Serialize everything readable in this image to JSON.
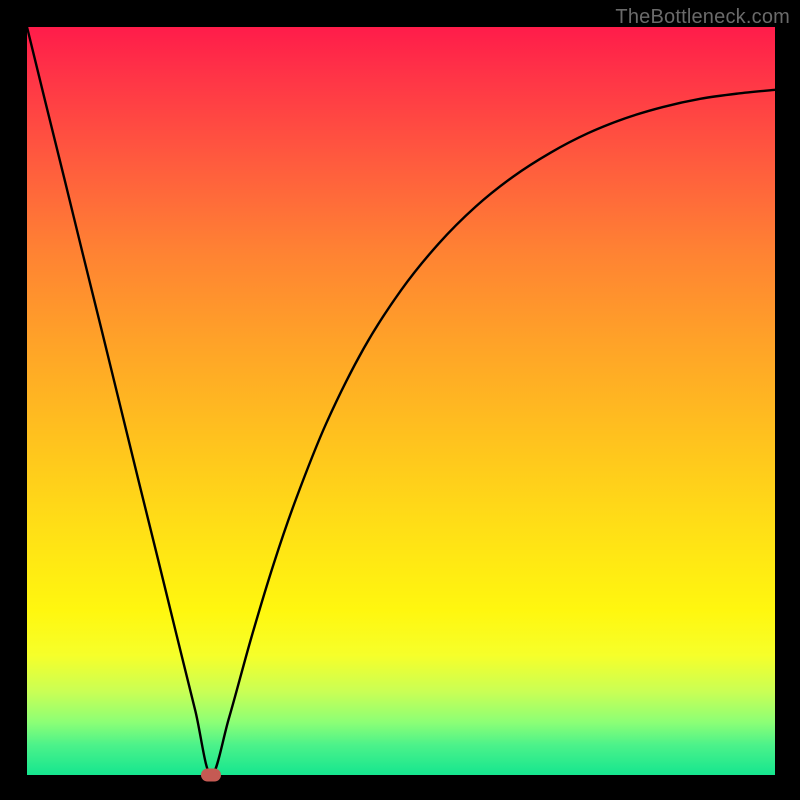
{
  "watermark": "TheBottleneck.com",
  "chart_data": {
    "type": "line",
    "title": "",
    "xlabel": "",
    "ylabel": "",
    "xlim": [
      0,
      1
    ],
    "ylim": [
      0,
      1
    ],
    "x": [
      0.0,
      0.025,
      0.05,
      0.075,
      0.1,
      0.125,
      0.15,
      0.175,
      0.2,
      0.225,
      0.246,
      0.27,
      0.3,
      0.33,
      0.36,
      0.4,
      0.45,
      0.5,
      0.55,
      0.6,
      0.65,
      0.7,
      0.75,
      0.8,
      0.85,
      0.9,
      0.95,
      1.0
    ],
    "values": [
      1.0,
      0.898,
      0.797,
      0.695,
      0.594,
      0.492,
      0.39,
      0.289,
      0.187,
      0.086,
      0.0,
      0.076,
      0.184,
      0.283,
      0.37,
      0.47,
      0.57,
      0.648,
      0.71,
      0.76,
      0.8,
      0.832,
      0.858,
      0.878,
      0.893,
      0.904,
      0.911,
      0.916
    ],
    "marker": {
      "x": 0.246,
      "y": 0.0
    }
  },
  "colors": {
    "curve": "#000000",
    "marker": "#c55a53",
    "gradient_top": "#ff1c4a",
    "gradient_bottom": "#15e68f"
  }
}
